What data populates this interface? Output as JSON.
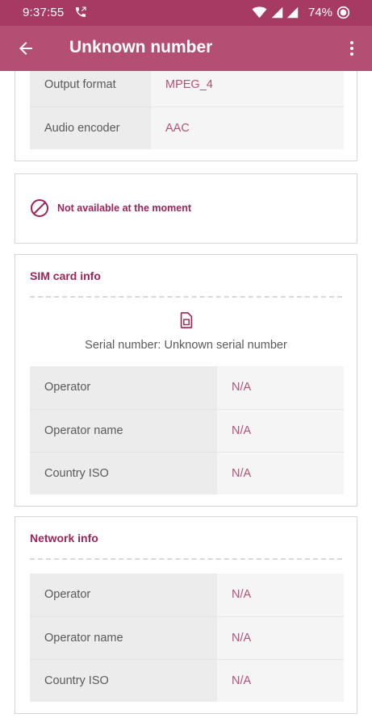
{
  "status_bar": {
    "time": "9:37:55",
    "battery": "74%"
  },
  "app_bar": {
    "title": "Unknown number"
  },
  "recording_card": {
    "rows": [
      {
        "label": "Output format",
        "value": "MPEG_4"
      },
      {
        "label": "Audio encoder",
        "value": "AAC"
      }
    ]
  },
  "availability_card": {
    "message": "Not available at the moment"
  },
  "sim_card": {
    "title": "SIM card info",
    "serial": "Serial number: Unknown serial number",
    "rows": [
      {
        "label": "Operator",
        "value": "N/A"
      },
      {
        "label": "Operator name",
        "value": "N/A"
      },
      {
        "label": "Country ISO",
        "value": "N/A"
      }
    ]
  },
  "network_card": {
    "title": "Network info",
    "rows": [
      {
        "label": "Operator",
        "value": "N/A"
      },
      {
        "label": "Operator name",
        "value": "N/A"
      },
      {
        "label": "Country ISO",
        "value": "N/A"
      }
    ]
  },
  "colors": {
    "status_bar": "#a63a62",
    "app_bar": "#b44f73",
    "accent": "#9b2459",
    "value_text": "#b0527a"
  },
  "icons": [
    "call-icon",
    "wifi-icon",
    "signal-icon",
    "battery-icon",
    "back-arrow-icon",
    "more-vert-icon",
    "block-icon",
    "sim-card-icon"
  ]
}
